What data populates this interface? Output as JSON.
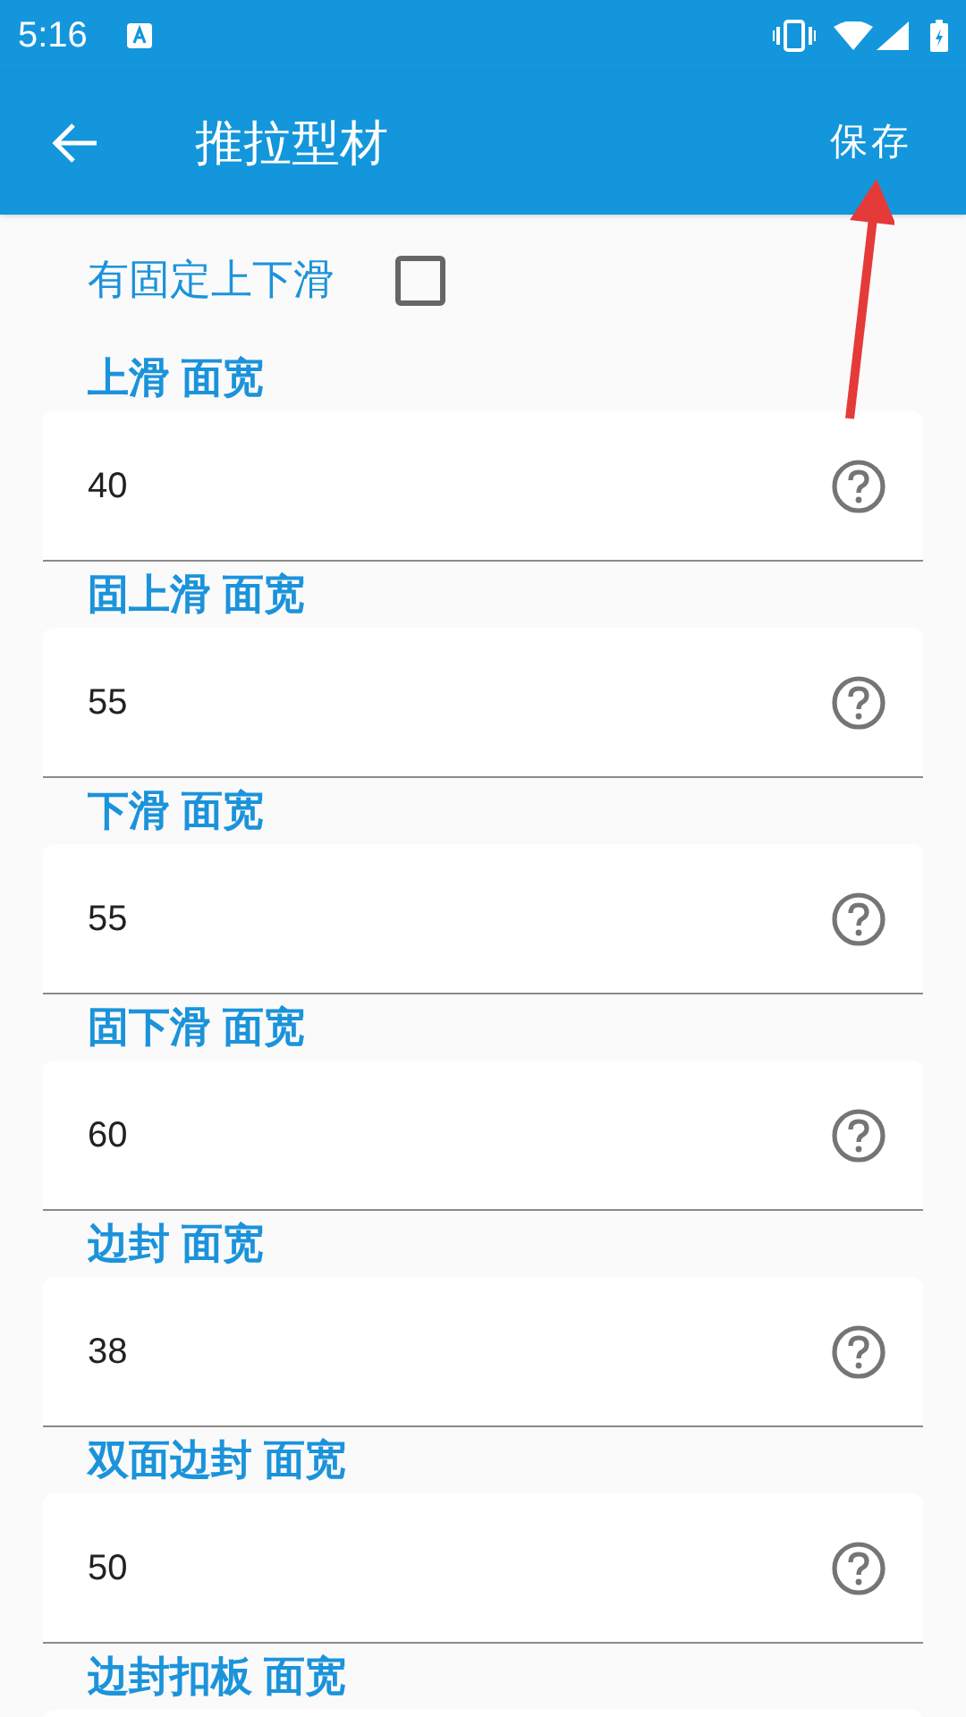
{
  "status_bar": {
    "time": "5:16"
  },
  "app_bar": {
    "title": "推拉型材",
    "action": "保存"
  },
  "fixed_slider": {
    "label": "有固定上下滑",
    "checked": false
  },
  "fields": [
    {
      "label": "上滑 面宽",
      "value": "40"
    },
    {
      "label": "固上滑 面宽",
      "value": "55"
    },
    {
      "label": "下滑 面宽",
      "value": "55"
    },
    {
      "label": "固下滑 面宽",
      "value": "60"
    },
    {
      "label": "边封 面宽",
      "value": "38"
    },
    {
      "label": "双面边封 面宽",
      "value": "50"
    },
    {
      "label": "边封扣板 面宽"
    }
  ]
}
